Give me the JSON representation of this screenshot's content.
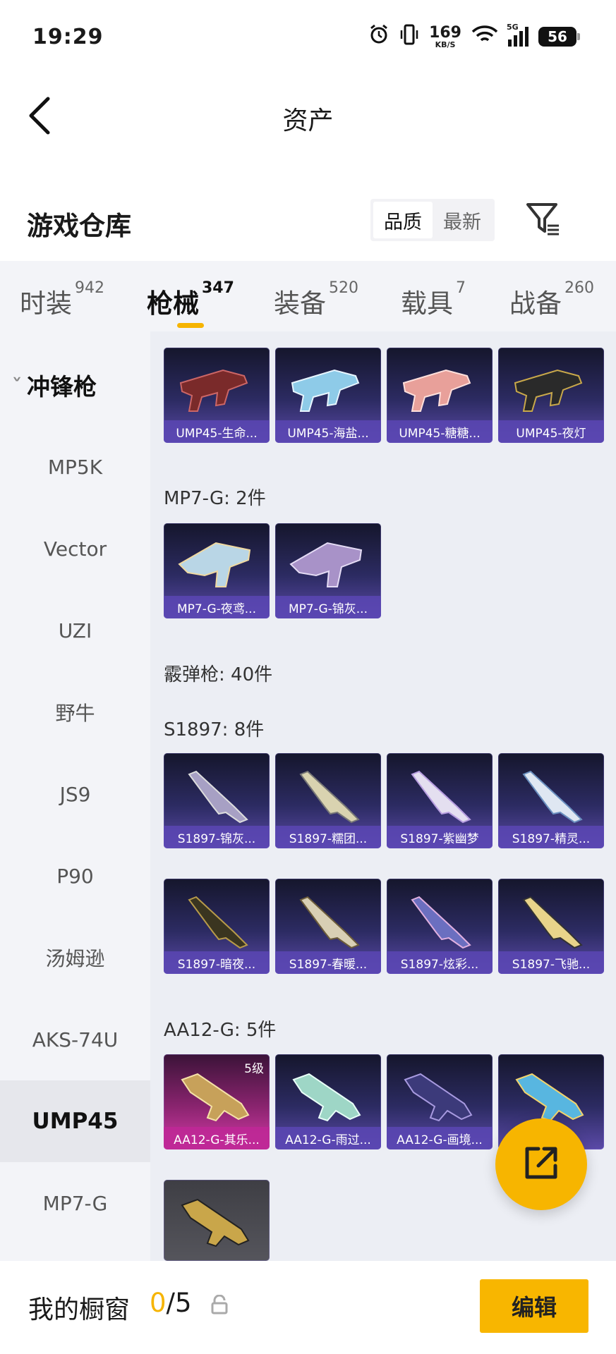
{
  "status_bar": {
    "time": "19:29",
    "net_speed_value": "169",
    "net_speed_unit": "KB/S",
    "network_type": "5G",
    "battery": "56"
  },
  "header": {
    "title": "资产",
    "back_icon": "chevron-left-icon"
  },
  "warehouse": {
    "title": "游戏仓库",
    "sort_options": [
      "品质",
      "最新"
    ],
    "sort_selected": "品质",
    "filter_icon": "filter-icon"
  },
  "tabs": [
    {
      "label": "时装",
      "count": "942"
    },
    {
      "label": "枪械",
      "count": "347",
      "active": true
    },
    {
      "label": "装备",
      "count": "520"
    },
    {
      "label": "载具",
      "count": "7"
    },
    {
      "label": "战备",
      "count": "260"
    }
  ],
  "sidebar": {
    "group": "冲锋枪",
    "items": [
      "MP5K",
      "Vector",
      "UZI",
      "野牛",
      "JS9",
      "P90",
      "汤姆逊",
      "AKS-74U",
      "UMP45",
      "MP7-G"
    ],
    "active": "UMP45"
  },
  "grid": {
    "ump45_items": [
      "UMP45-生命...",
      "UMP45-海盐...",
      "UMP45-糖糖...",
      "UMP45-夜灯"
    ],
    "mp7_header": "MP7-G: 2件",
    "mp7_items": [
      "MP7-G-夜鸢...",
      "MP7-G-锦灰..."
    ],
    "shotgun_header": "霰弹枪: 40件",
    "s1897_header": "S1897: 8件",
    "s1897_items": [
      "S1897-锦灰...",
      "S1897-糯团...",
      "S1897-紫幽梦",
      "S1897-精灵...",
      "S1897-暗夜...",
      "S1897-春暖...",
      "S1897-炫彩...",
      "S1897-飞驰..."
    ],
    "aa12_header": "AA12-G: 5件",
    "aa12_items": [
      "AA12-G-其乐...",
      "AA12-G-雨过...",
      "AA12-G-画境..."
    ],
    "aa12_level_badge": "5级"
  },
  "share_icon": "share-external-icon",
  "bottom": {
    "label": "我的橱窗",
    "count_current": "0",
    "count_total": "/5",
    "lock_icon": "lock-icon",
    "edit_label": "编辑"
  },
  "colors": {
    "accent": "#f6b400",
    "card_purple": "#5b4aa8",
    "card_pink": "#d43aa6"
  }
}
